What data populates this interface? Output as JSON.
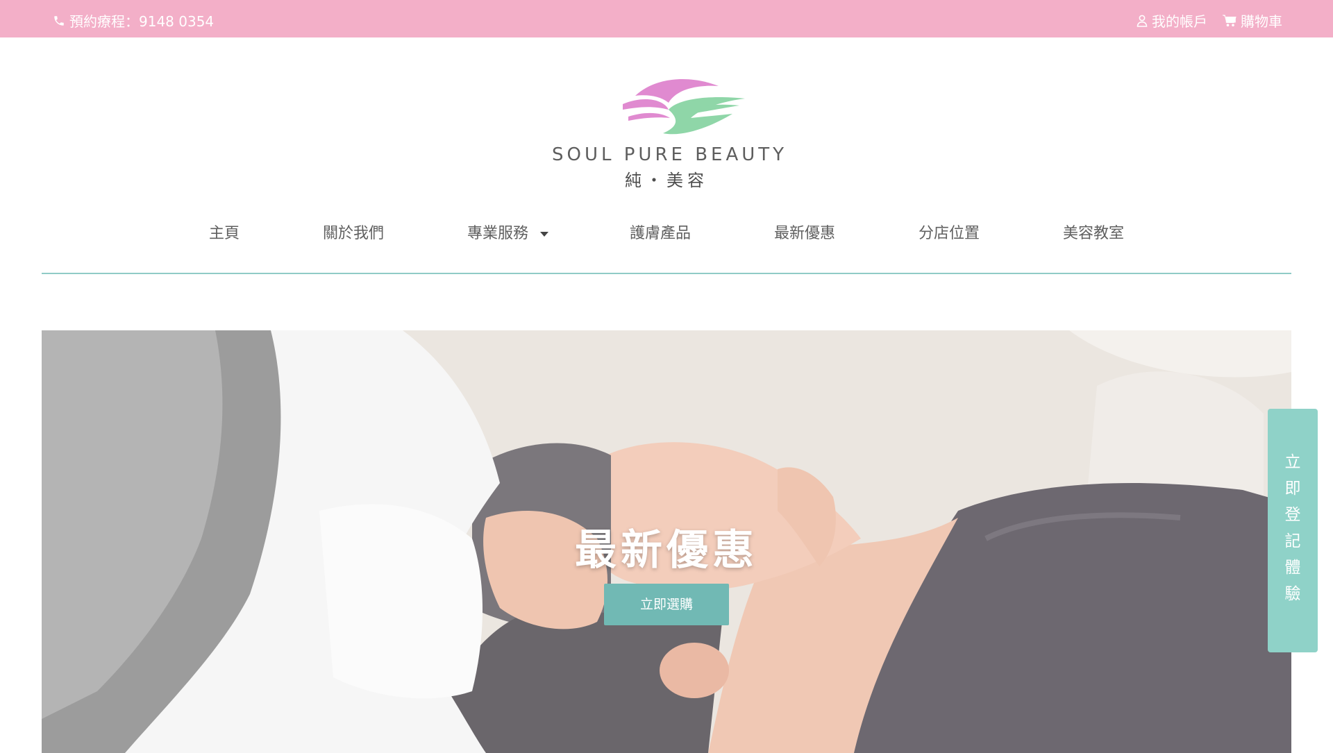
{
  "topbar": {
    "phone_label": "預約療程：9148 0354",
    "account_label": "我的帳戶",
    "cart_label": "購物車"
  },
  "logo": {
    "en": "SOUL PURE BEAUTY",
    "zh": "純・美容"
  },
  "nav": {
    "items": [
      {
        "label": "主頁"
      },
      {
        "label": "關於我們"
      },
      {
        "label": "專業服務"
      },
      {
        "label": "護膚產品"
      },
      {
        "label": "最新優惠"
      },
      {
        "label": "分店位置"
      },
      {
        "label": "美容教室"
      }
    ]
  },
  "hero": {
    "title": "最新優惠",
    "button": "立即選購"
  },
  "sidetab": {
    "chars": [
      "立",
      "即",
      "登",
      "記",
      "體",
      "驗"
    ]
  },
  "colors": {
    "topbar": "#f3afc8",
    "accent": "#71b9b4",
    "sidetab": "#8fd2c8",
    "divider": "#8fcbc6"
  },
  "icons": [
    "phone-icon",
    "user-icon",
    "cart-icon",
    "chevron-down-icon"
  ]
}
